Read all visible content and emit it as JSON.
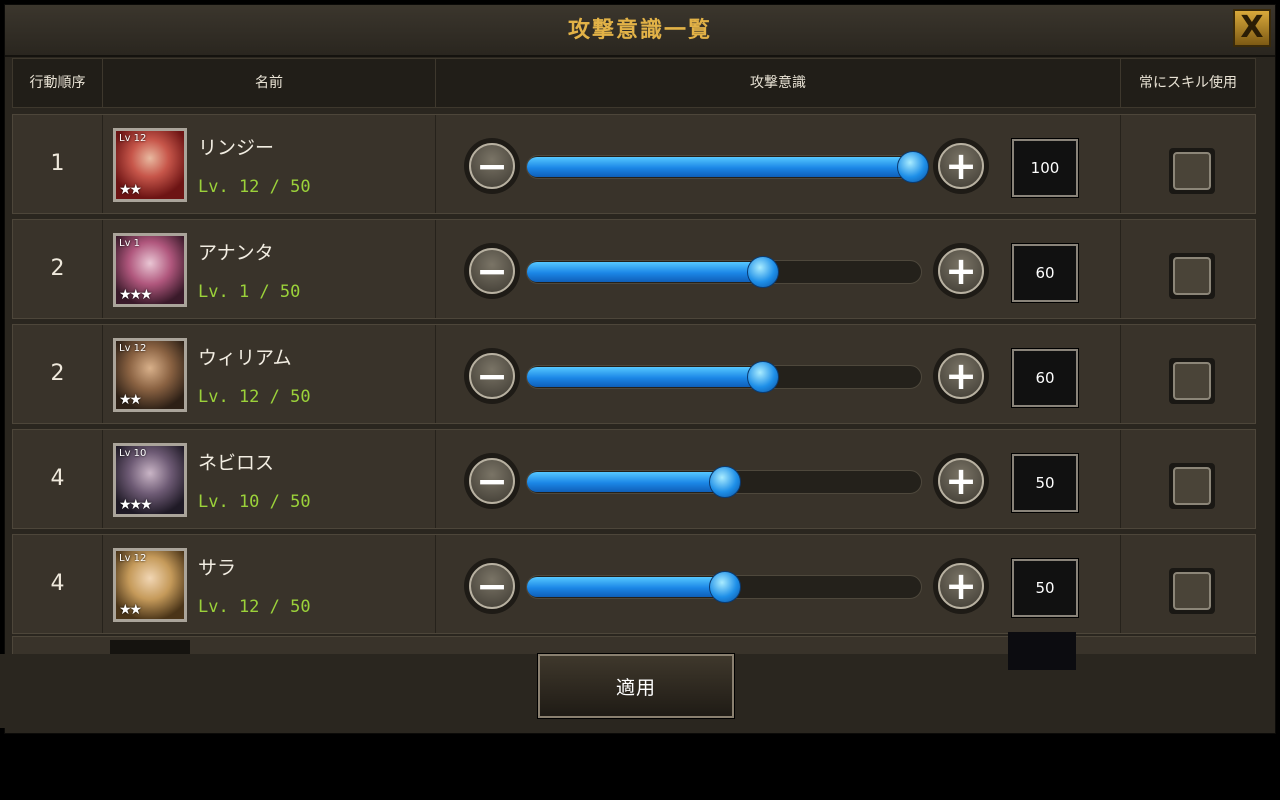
{
  "title": "攻撃意識一覧",
  "close_label": "X",
  "headers": {
    "order": "行動順序",
    "name": "名前",
    "aggression": "攻撃意識",
    "always_skill": "常にスキル使用"
  },
  "rows": [
    {
      "order": "1",
      "name": "リンジー",
      "level_text": "Lv. 12 / 50",
      "portrait_lv": "Lv 12",
      "stars": "★★",
      "value": "100",
      "slider_fraction": 1.0,
      "always_skill": false
    },
    {
      "order": "2",
      "name": "アナンタ",
      "level_text": "Lv. 1 / 50",
      "portrait_lv": "Lv 1",
      "stars": "★★★",
      "value": "60",
      "slider_fraction": 0.6,
      "always_skill": false
    },
    {
      "order": "2",
      "name": "ウィリアム",
      "level_text": "Lv. 12 / 50",
      "portrait_lv": "Lv 12",
      "stars": "★★",
      "value": "60",
      "slider_fraction": 0.6,
      "always_skill": false
    },
    {
      "order": "4",
      "name": "ネビロス",
      "level_text": "Lv. 10 / 50",
      "portrait_lv": "Lv 10",
      "stars": "★★★",
      "value": "50",
      "slider_fraction": 0.5,
      "always_skill": false
    },
    {
      "order": "4",
      "name": "サラ",
      "level_text": "Lv. 12 / 50",
      "portrait_lv": "Lv 12",
      "stars": "★★",
      "value": "50",
      "slider_fraction": 0.5,
      "always_skill": false
    }
  ],
  "apply_label": "適用",
  "colors": {
    "title_gold": "#e2b247",
    "level_green": "#9bd23a",
    "slider_blue": "#1b86e6",
    "panel_bg": "#2a261f"
  }
}
